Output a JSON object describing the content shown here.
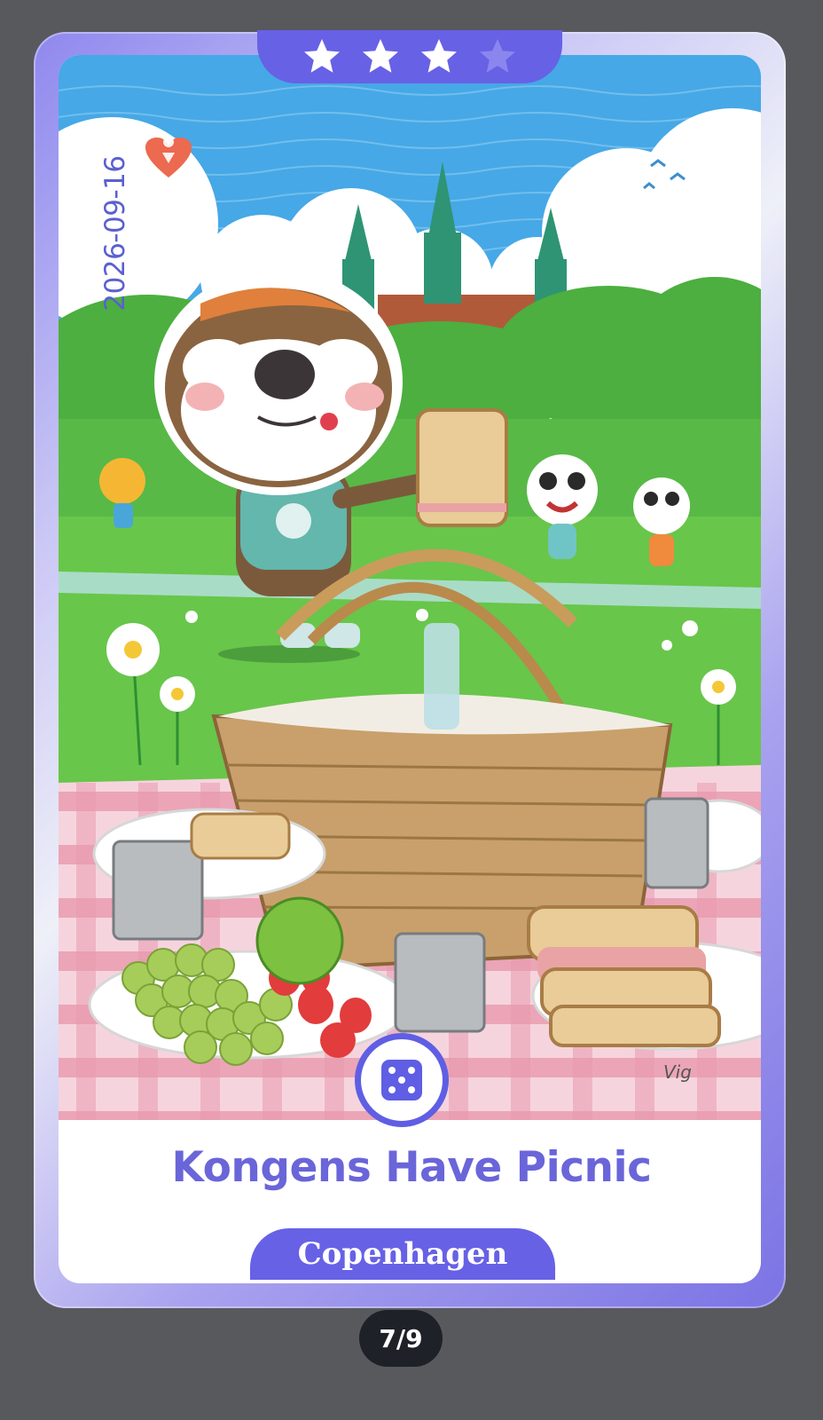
{
  "card": {
    "rating": {
      "filled": 3,
      "total": 4
    },
    "date": "2026-09-16",
    "title": "Kongens Have Picnic",
    "city": "Copenhagen",
    "artist": "Vig",
    "colors": {
      "accent": "#6761e6",
      "title": "#6a65d9",
      "date": "#5b60cf",
      "heart": "#ec6a4f"
    }
  },
  "pager": {
    "label": "7/9",
    "current": 7,
    "total": 9
  },
  "icons": {
    "favorite": "heart-location-icon",
    "roll": "dice-icon",
    "star": "star-icon"
  }
}
